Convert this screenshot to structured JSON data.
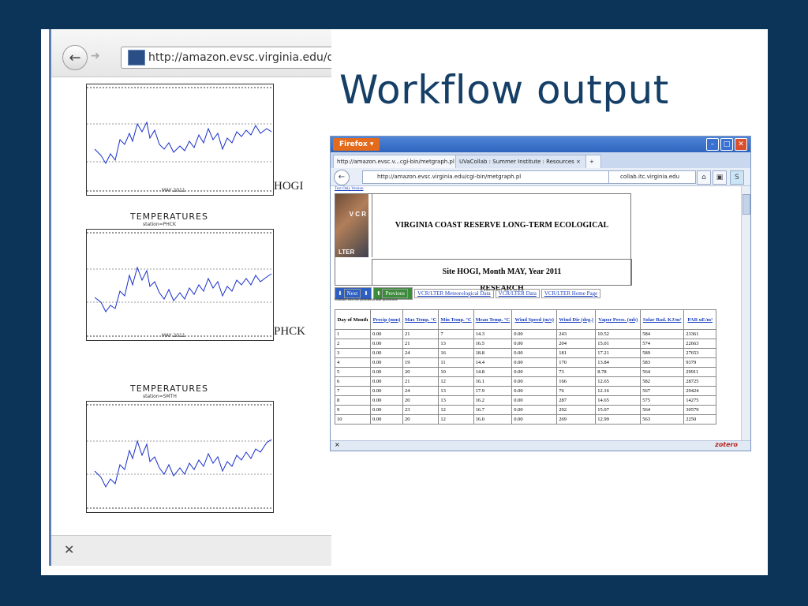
{
  "slide": {
    "title": "Workflow output"
  },
  "left_browser": {
    "url": "http://amazon.evsc.virginia.edu/da",
    "plots": [
      {
        "station_label": "HOGI",
        "x_label": "MAY 2011"
      },
      {
        "title": "TEMPERATURES",
        "subtitle": "station=PHCK",
        "station_label": "PHCK",
        "x_label": "MAY 2011"
      },
      {
        "title": "TEMPERATURES",
        "subtitle": "station=SMTH"
      }
    ],
    "status_close": "✕"
  },
  "right_browser": {
    "app_button": "Firefox",
    "tabs": [
      {
        "label": "http://amazon.evsc.v...cgi-bin/metgraph.pl ×"
      },
      {
        "label": "UVaCollab : Summer Institute : Resources ×"
      }
    ],
    "new_tab": "+",
    "url": "http://amazon.evsc.virginia.edu/cgi-bin/metgraph.pl",
    "search": "collab.itc.virginia.edu",
    "status_left": "×",
    "status_right": "zotero",
    "page": {
      "text_only_link": "Text Only Version",
      "header": "VIRGINIA COAST RESERVE LONG-TERM ECOLOGICAL RESEARCH",
      "logo_text": "LTER",
      "logo_letters": "V C R",
      "site_line": "Site HOGI, Month MAY, Year 2011",
      "nav": {
        "next": "Next",
        "previous": "Previous",
        "link1": "VCR/LTER Meteorological Data",
        "link2": "VCR/LTER Data",
        "link3": "VCR/LTER Home Page"
      },
      "contact_note": "Contact Jim for problems and questions",
      "columns": [
        "Day of Month",
        "Precip (mm)",
        "Max Temp. °C",
        "Min Temp. °C",
        "Mean Temp. °C",
        "Wind Speed (m/s)",
        "Wind Dir (deg.)",
        "Vapor Press. (mb)",
        "Solar Rad. KJ/m²",
        "PAR uE/m²"
      ],
      "rows": [
        [
          "1",
          "0.00",
          "21",
          "7",
          "14.3",
          "0.00",
          "243",
          "10.52",
          "584",
          "23361"
        ],
        [
          "2",
          "0.00",
          "21",
          "13",
          "16.5",
          "0.00",
          "204",
          "15.01",
          "574",
          "22663"
        ],
        [
          "3",
          "0.00",
          "24",
          "16",
          "18.8",
          "0.00",
          "181",
          "17.21",
          "589",
          "27653"
        ],
        [
          "4",
          "0.00",
          "19",
          "11",
          "14.4",
          "0.00",
          "170",
          "13.84",
          "583",
          "9379"
        ],
        [
          "5",
          "0.00",
          "20",
          "10",
          "14.8",
          "0.00",
          "73",
          "8.78",
          "564",
          "29911"
        ],
        [
          "6",
          "0.00",
          "21",
          "12",
          "16.1",
          "0.00",
          "166",
          "12.65",
          "582",
          "28725"
        ],
        [
          "7",
          "0.00",
          "24",
          "13",
          "17.9",
          "0.00",
          "76",
          "12.16",
          "567",
          "29424"
        ],
        [
          "8",
          "0.00",
          "20",
          "13",
          "16.2",
          "0.00",
          "287",
          "14.65",
          "575",
          "14275"
        ],
        [
          "9",
          "0.00",
          "23",
          "12",
          "16.7",
          "0.00",
          "292",
          "15.07",
          "564",
          "30579"
        ],
        [
          "10",
          "0.00",
          "20",
          "12",
          "16.0",
          "0.00",
          "269",
          "12.99",
          "563",
          "2250"
        ]
      ]
    }
  }
}
